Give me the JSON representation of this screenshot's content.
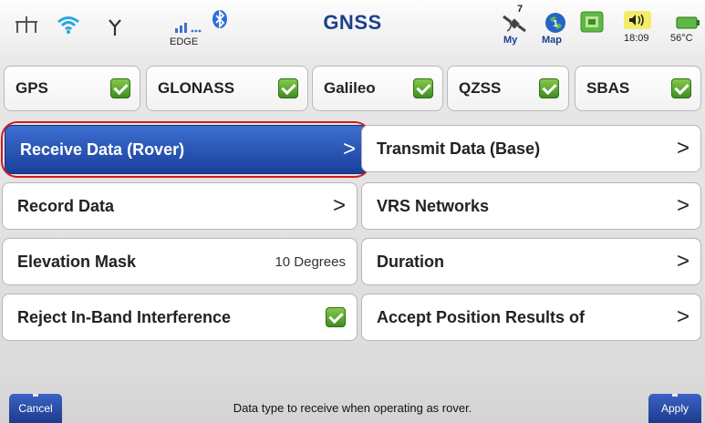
{
  "app": {
    "title": "GNSS"
  },
  "status_bar": {
    "icons": [
      "network-icon",
      "wifi-icon",
      "antenna-icon",
      "signal-bars-icon",
      "bluetooth-icon",
      "satellite-icon",
      "map-globe-icon",
      "gps-fix-icon",
      "speaker-icon",
      "battery-icon"
    ],
    "network_type": "EDGE",
    "satellite_count": "7",
    "my_label": "My",
    "map_label": "Map",
    "time": "18:09",
    "temperature": "56°C"
  },
  "constellations": [
    {
      "label": "GPS",
      "checked": true
    },
    {
      "label": "GLONASS",
      "checked": true
    },
    {
      "label": "Galileo",
      "checked": true
    },
    {
      "label": "QZSS",
      "checked": true
    },
    {
      "label": "SBAS",
      "checked": true
    }
  ],
  "menu": {
    "left": [
      {
        "label": "Receive Data (Rover)",
        "chevron": ">",
        "selected": true
      },
      {
        "label": "Record Data",
        "chevron": ">"
      },
      {
        "label": "Elevation Mask",
        "value": "10 Degrees"
      },
      {
        "label": "Reject In-Band Interference",
        "checked": true
      }
    ],
    "right": [
      {
        "label": "Transmit Data (Base)",
        "chevron": ">"
      },
      {
        "label": "VRS Networks",
        "chevron": ">"
      },
      {
        "label": "Duration",
        "chevron": ">"
      },
      {
        "label": "Accept Position Results of",
        "chevron": ">"
      }
    ]
  },
  "footer": {
    "cancel_label": "Cancel",
    "apply_label": "Apply",
    "help_text": "Data type to receive when operating as rover."
  },
  "colors": {
    "accent_blue": "#1a3f9a",
    "title_blue": "#1d3f8f",
    "check_green": "#3f8c22",
    "highlight_red": "#d4191c"
  }
}
